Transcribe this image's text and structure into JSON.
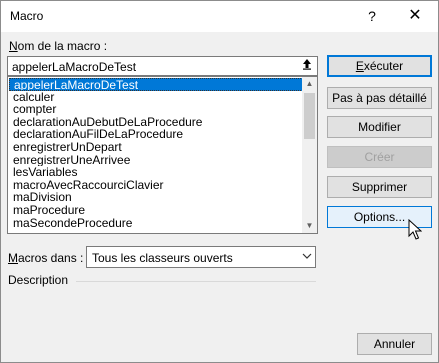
{
  "window": {
    "title": "Macro",
    "help_label": "?",
    "close_label": "✕"
  },
  "macro_name": {
    "label_accel": "N",
    "label_rest": "om de la macro :",
    "value": "appelerLaMacroDeTest"
  },
  "macro_list": {
    "items": [
      "appelerLaMacroDeTest",
      "calculer",
      "compter",
      "declarationAuDebutDeLaProcedure",
      "declarationAuFilDeLaProcedure",
      "enregistrerUnDepart",
      "enregistrerUneArrivee",
      "lesVariables",
      "macroAvecRaccourciClavier",
      "maDivision",
      "maProcedure",
      "maSecondeProcedure"
    ],
    "selected_index": 0
  },
  "buttons": {
    "execute_accel": "E",
    "execute_rest": "xécuter",
    "step_into": "Pas à pas détaillé",
    "modify": "Modifier",
    "create": "Créer",
    "delete": "Supprimer",
    "options": "Options...",
    "cancel": "Annuler"
  },
  "macros_in": {
    "label_accel": "M",
    "label_rest": "acros dans :",
    "value": "Tous les classeurs ouverts"
  },
  "description": {
    "label": "Description"
  }
}
